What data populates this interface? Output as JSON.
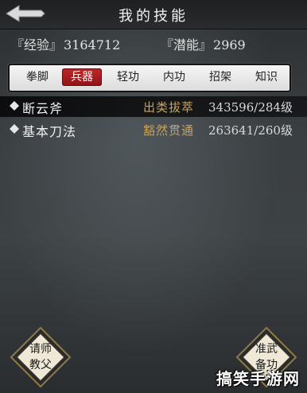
{
  "header": {
    "title": "我的技能"
  },
  "stats": {
    "exp_label": "『经验』",
    "exp_value": "3164712",
    "potential_label": "『潜能』",
    "potential_value": "2969"
  },
  "tabs": [
    {
      "label": "拳脚",
      "active": false
    },
    {
      "label": "兵器",
      "active": true
    },
    {
      "label": "轻功",
      "active": false
    },
    {
      "label": "内功",
      "active": false
    },
    {
      "label": "招架",
      "active": false
    },
    {
      "label": "知识",
      "active": false
    }
  ],
  "skills": [
    {
      "name": "断云斧",
      "rank": "出类拔萃",
      "progress": "343596/284级",
      "selected": true
    },
    {
      "name": "基本刀法",
      "rank": "豁然贯通",
      "progress": "263641/260级",
      "selected": false
    }
  ],
  "buttons": {
    "left_line1": "请师",
    "left_line2": "教父",
    "right_line1": "准武",
    "right_line2": "备功"
  },
  "watermark": "搞笑手游网"
}
